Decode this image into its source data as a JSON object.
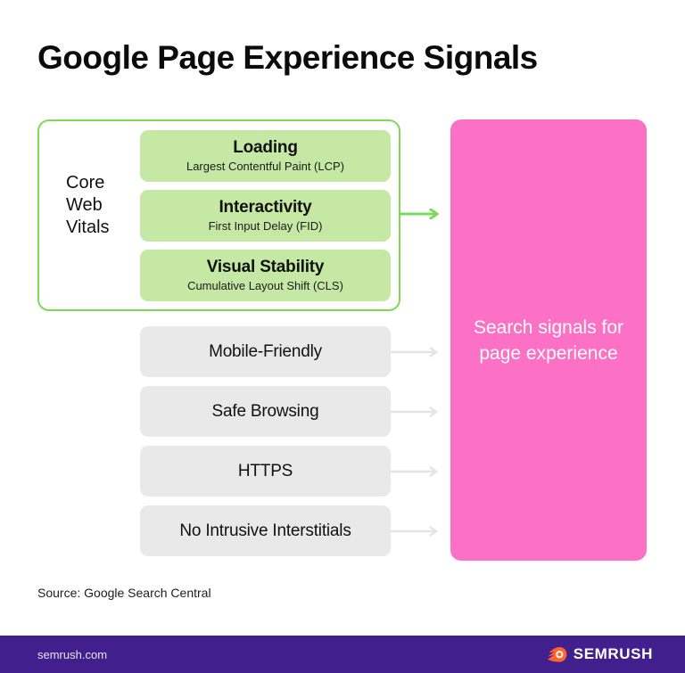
{
  "title": "Google Page Experience Signals",
  "core_web_vitals": {
    "label_lines": [
      "Core",
      "Web",
      "Vitals"
    ],
    "border_color": "#7ed957",
    "box_color": "#c5e8a4",
    "items": [
      {
        "title": "Loading",
        "subtitle": "Largest Contentful Paint (LCP)"
      },
      {
        "title": "Interactivity",
        "subtitle": "First Input Delay (FID)"
      },
      {
        "title": "Visual Stability",
        "subtitle": "Cumulative Layout Shift (CLS)"
      }
    ]
  },
  "other_signals": {
    "box_color": "#e9e9e9",
    "arrow_color": "#e4e4e4",
    "items": [
      {
        "label": "Mobile-Friendly"
      },
      {
        "label": "Safe Browsing"
      },
      {
        "label": "HTTPS"
      },
      {
        "label": "No Intrusive Interstitials"
      }
    ]
  },
  "outcome_panel": {
    "text": "Search signals for page experience",
    "color": "#fc71c5",
    "text_color": "#ffffff"
  },
  "source": "Source: Google Search Central",
  "footer": {
    "url": "semrush.com",
    "brand": "SEMRUSH",
    "bar_color": "#41208d",
    "logo_color": "#ff642d"
  }
}
